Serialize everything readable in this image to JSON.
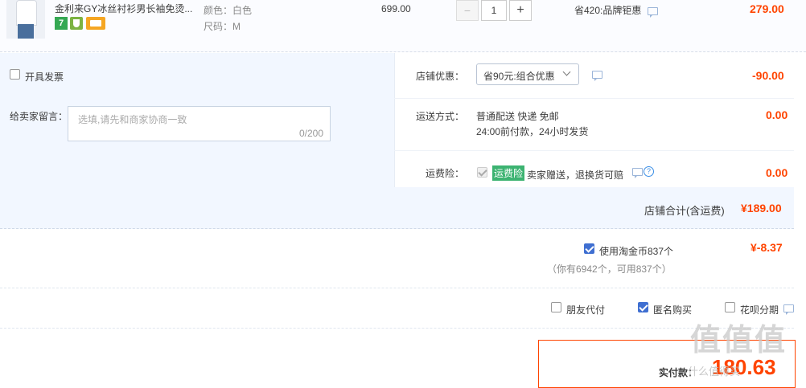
{
  "item": {
    "title": "金利来GY冰丝衬衫男长袖免烫...",
    "badge_seven": "7",
    "sku_color": "颜色：白色",
    "sku_size": "尺码：M",
    "unit_price": "699.00",
    "quantity": "1",
    "minus": "−",
    "plus": "+",
    "promo": "省420:品牌钜惠",
    "subtotal": "279.00"
  },
  "invoice": {
    "label": "开具发票"
  },
  "shop_discount": {
    "label": "店铺优惠：",
    "selected": "省90元:组合优惠",
    "amount": "-90.00"
  },
  "message": {
    "label": "给卖家留言：",
    "placeholder": "选填,请先和商家协商一致",
    "counter": "0/200"
  },
  "shipping": {
    "label": "运送方式：",
    "method": "普通配送 快递 免邮",
    "note": "24:00前付款，24小时发货",
    "amount": "0.00"
  },
  "insurance": {
    "label": "运费险：",
    "badge": "运费险",
    "text": "卖家赠送，退换货可赔",
    "amount": "0.00"
  },
  "shop_total": {
    "label": "店铺合计(含运费)",
    "amount": "¥189.00"
  },
  "coins": {
    "label": "使用淘金币837个",
    "note": "（你有6942个，可用837个）",
    "amount": "¥-8.37"
  },
  "options": {
    "friend_pay": "朋友代付",
    "anonymous": "匿名购买",
    "huabei": "花呗分期"
  },
  "payment": {
    "label": "实付款：",
    "amount": "180.63"
  },
  "watermark": {
    "text": "值值值",
    "sub": "什么值得买"
  },
  "colors": {
    "price_red": "#f40",
    "section_bg": "#f2f7ff",
    "accent_blue": "#3f6fd1",
    "badge_green": "#3cb371"
  },
  "icons": [
    "product-thumbnail",
    "speech-bubble-icon",
    "help-icon",
    "chevron-down-icon",
    "checkbox-icon"
  ]
}
